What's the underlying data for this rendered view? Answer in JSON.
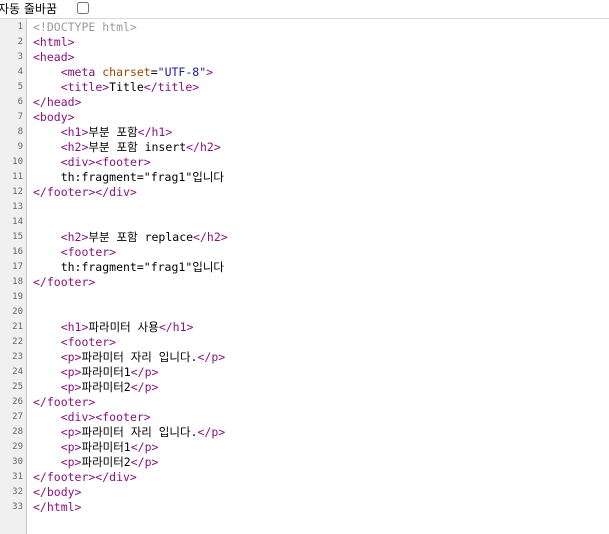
{
  "toolbar": {
    "wrap_label": "자동 줄바꿈",
    "wrap_checked": false
  },
  "colors": {
    "tag": "#881280",
    "attribute": "#994500",
    "attribute_value": "#1a1aa6",
    "doctype": "#9a9a9a",
    "text": "#000000"
  },
  "lines": [
    {
      "n": "1",
      "tokens": [
        {
          "t": "cmt",
          "v": "<!DOCTYPE html>"
        }
      ]
    },
    {
      "n": "2",
      "tokens": [
        {
          "t": "tag",
          "v": "<html>"
        }
      ]
    },
    {
      "n": "3",
      "tokens": [
        {
          "t": "tag",
          "v": "<head>"
        }
      ]
    },
    {
      "n": "4",
      "tokens": [
        {
          "t": "txt",
          "v": "    "
        },
        {
          "t": "tag",
          "v": "<meta "
        },
        {
          "t": "attr",
          "v": "charset"
        },
        {
          "t": "txt",
          "v": "="
        },
        {
          "t": "val",
          "v": "\"UTF-8\""
        },
        {
          "t": "tag",
          "v": ">"
        }
      ]
    },
    {
      "n": "5",
      "tokens": [
        {
          "t": "txt",
          "v": "    "
        },
        {
          "t": "tag",
          "v": "<title>"
        },
        {
          "t": "txt",
          "v": "Title"
        },
        {
          "t": "tag",
          "v": "</title>"
        }
      ]
    },
    {
      "n": "6",
      "tokens": [
        {
          "t": "tag",
          "v": "</head>"
        }
      ]
    },
    {
      "n": "7",
      "tokens": [
        {
          "t": "tag",
          "v": "<body>"
        }
      ]
    },
    {
      "n": "8",
      "tokens": [
        {
          "t": "txt",
          "v": "    "
        },
        {
          "t": "tag",
          "v": "<h1>"
        },
        {
          "t": "txt",
          "v": "부분 포함"
        },
        {
          "t": "tag",
          "v": "</h1>"
        }
      ]
    },
    {
      "n": "9",
      "tokens": [
        {
          "t": "txt",
          "v": "    "
        },
        {
          "t": "tag",
          "v": "<h2>"
        },
        {
          "t": "txt",
          "v": "부분 포함 insert"
        },
        {
          "t": "tag",
          "v": "</h2>"
        }
      ]
    },
    {
      "n": "10",
      "tokens": [
        {
          "t": "txt",
          "v": "    "
        },
        {
          "t": "tag",
          "v": "<div><footer>"
        }
      ]
    },
    {
      "n": "11",
      "tokens": [
        {
          "t": "txt",
          "v": "    th:fragment=\"frag1\"입니다"
        }
      ]
    },
    {
      "n": "12",
      "tokens": [
        {
          "t": "tag",
          "v": "</footer></div>"
        }
      ]
    },
    {
      "n": "13",
      "tokens": []
    },
    {
      "n": "14",
      "tokens": []
    },
    {
      "n": "15",
      "tokens": [
        {
          "t": "txt",
          "v": "    "
        },
        {
          "t": "tag",
          "v": "<h2>"
        },
        {
          "t": "txt",
          "v": "부분 포함 replace"
        },
        {
          "t": "tag",
          "v": "</h2>"
        }
      ]
    },
    {
      "n": "16",
      "tokens": [
        {
          "t": "txt",
          "v": "    "
        },
        {
          "t": "tag",
          "v": "<footer>"
        }
      ]
    },
    {
      "n": "17",
      "tokens": [
        {
          "t": "txt",
          "v": "    th:fragment=\"frag1\"입니다"
        }
      ]
    },
    {
      "n": "18",
      "tokens": [
        {
          "t": "tag",
          "v": "</footer>"
        }
      ]
    },
    {
      "n": "19",
      "tokens": []
    },
    {
      "n": "20",
      "tokens": []
    },
    {
      "n": "21",
      "tokens": [
        {
          "t": "txt",
          "v": "    "
        },
        {
          "t": "tag",
          "v": "<h1>"
        },
        {
          "t": "txt",
          "v": "파라미터 사용"
        },
        {
          "t": "tag",
          "v": "</h1>"
        }
      ]
    },
    {
      "n": "22",
      "tokens": [
        {
          "t": "txt",
          "v": "    "
        },
        {
          "t": "tag",
          "v": "<footer>"
        }
      ]
    },
    {
      "n": "23",
      "tokens": [
        {
          "t": "txt",
          "v": "    "
        },
        {
          "t": "tag",
          "v": "<p>"
        },
        {
          "t": "txt",
          "v": "파라미터 자리 입니다."
        },
        {
          "t": "tag",
          "v": "</p>"
        }
      ]
    },
    {
      "n": "24",
      "tokens": [
        {
          "t": "txt",
          "v": "    "
        },
        {
          "t": "tag",
          "v": "<p>"
        },
        {
          "t": "txt",
          "v": "파라미터1"
        },
        {
          "t": "tag",
          "v": "</p>"
        }
      ]
    },
    {
      "n": "25",
      "tokens": [
        {
          "t": "txt",
          "v": "    "
        },
        {
          "t": "tag",
          "v": "<p>"
        },
        {
          "t": "txt",
          "v": "파라미터2"
        },
        {
          "t": "tag",
          "v": "</p>"
        }
      ]
    },
    {
      "n": "26",
      "tokens": [
        {
          "t": "tag",
          "v": "</footer>"
        }
      ]
    },
    {
      "n": "27",
      "tokens": [
        {
          "t": "txt",
          "v": "    "
        },
        {
          "t": "tag",
          "v": "<div><footer>"
        }
      ]
    },
    {
      "n": "28",
      "tokens": [
        {
          "t": "txt",
          "v": "    "
        },
        {
          "t": "tag",
          "v": "<p>"
        },
        {
          "t": "txt",
          "v": "파라미터 자리 입니다."
        },
        {
          "t": "tag",
          "v": "</p>"
        }
      ]
    },
    {
      "n": "29",
      "tokens": [
        {
          "t": "txt",
          "v": "    "
        },
        {
          "t": "tag",
          "v": "<p>"
        },
        {
          "t": "txt",
          "v": "파라미터1"
        },
        {
          "t": "tag",
          "v": "</p>"
        }
      ]
    },
    {
      "n": "30",
      "tokens": [
        {
          "t": "txt",
          "v": "    "
        },
        {
          "t": "tag",
          "v": "<p>"
        },
        {
          "t": "txt",
          "v": "파라미터2"
        },
        {
          "t": "tag",
          "v": "</p>"
        }
      ]
    },
    {
      "n": "31",
      "tokens": [
        {
          "t": "tag",
          "v": "</footer></div>"
        }
      ]
    },
    {
      "n": "32",
      "tokens": [
        {
          "t": "tag",
          "v": "</body>"
        }
      ]
    },
    {
      "n": "33",
      "tokens": [
        {
          "t": "tag",
          "v": "</html>"
        }
      ]
    }
  ]
}
